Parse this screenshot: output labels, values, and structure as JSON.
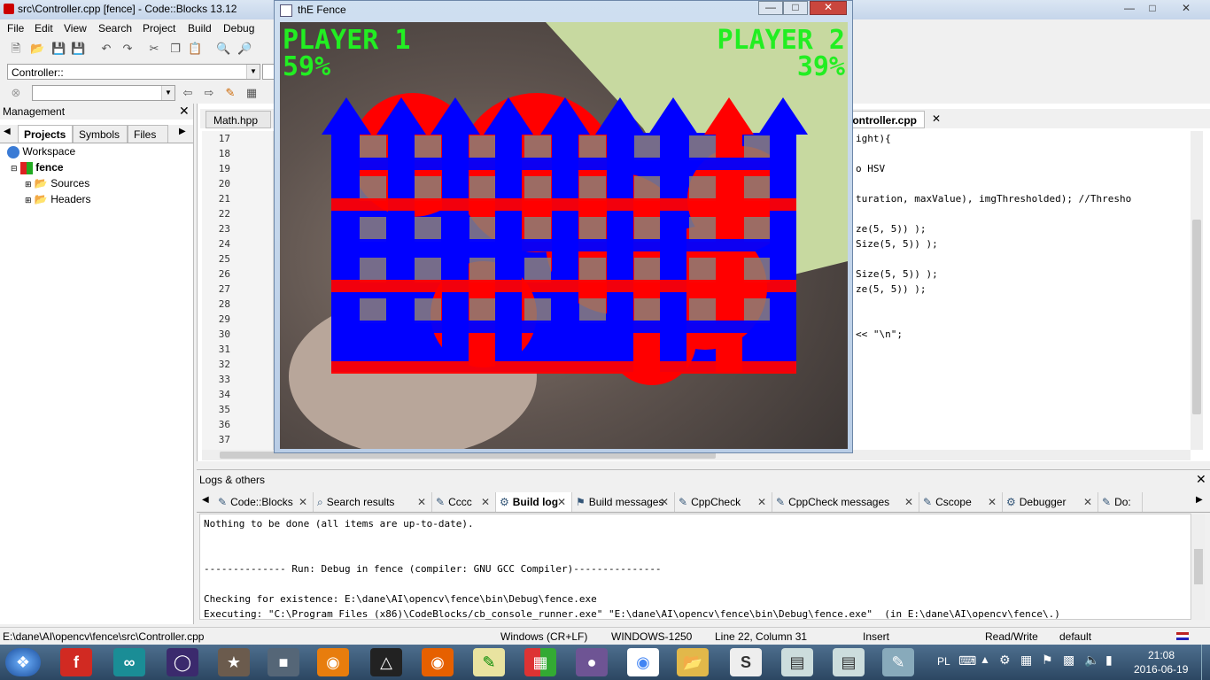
{
  "ide": {
    "title": "src\\Controller.cpp [fence] - Code::Blocks 13.12",
    "menu": [
      "File",
      "Edit",
      "Search",
      "View",
      "Project",
      "Build",
      "Debug",
      "Fortran"
    ],
    "scope_combo": "Controller::",
    "search_combo": ""
  },
  "management": {
    "title": "Management",
    "tabs": [
      "Projects",
      "Symbols",
      "Files"
    ],
    "tree": {
      "workspace": "Workspace",
      "project": "fence",
      "folders": [
        "Sources",
        "Headers"
      ]
    }
  },
  "editor": {
    "tabs": [
      "Math.hpp",
      "Controller.cpp"
    ],
    "line_numbers": [
      "17",
      "18",
      "19",
      "20",
      "21",
      "22",
      "23",
      "24",
      "25",
      "26",
      "27",
      "28",
      "29",
      "30",
      "31",
      "32",
      "33",
      "34",
      "35",
      "36",
      "37"
    ],
    "visible_code": [
      {
        "line": "17",
        "text": "ight){"
      },
      {
        "line": "19",
        "text": "o HSV"
      },
      {
        "line": "21",
        "text": "turation, maxValue), imgThresholded); //Thresho"
      },
      {
        "line": "23",
        "text": "ze(5, 5)) );"
      },
      {
        "line": "24",
        "text": "Size(5, 5)) );"
      },
      {
        "line": "26",
        "text": "Size(5, 5)) );"
      },
      {
        "line": "27",
        "text": "ze(5, 5)) );"
      },
      {
        "line": "30",
        "text": "<< \"\\n\";"
      }
    ]
  },
  "fence_window": {
    "title": "thE Fence",
    "player1_label": "PLAYER 1",
    "player1_score": "59%",
    "player2_label": "PLAYER 2",
    "player2_score": "39%",
    "player1_color": "#0000ff",
    "player2_color": "#ff0000",
    "score_color": "#22ee22"
  },
  "logs": {
    "title": "Logs & others",
    "tabs": [
      {
        "label": "Code::Blocks",
        "icon": "doc-icon"
      },
      {
        "label": "Search results",
        "icon": "search-icon"
      },
      {
        "label": "Cccc",
        "icon": "doc-icon"
      },
      {
        "label": "Build log",
        "icon": "gear-icon"
      },
      {
        "label": "Build messages",
        "icon": "pin-icon"
      },
      {
        "label": "CppCheck",
        "icon": "doc-icon"
      },
      {
        "label": "CppCheck messages",
        "icon": "doc-icon"
      },
      {
        "label": "Cscope",
        "icon": "doc-icon"
      },
      {
        "label": "Debugger",
        "icon": "gear-icon"
      },
      {
        "label": "Do:",
        "icon": "doc-icon"
      }
    ],
    "active_tab": "Build log",
    "lines": [
      "Nothing to be done (all items are up-to-date).",
      "",
      "",
      "-------------- Run: Debug in fence (compiler: GNU GCC Compiler)---------------",
      "",
      "Checking for existence: E:\\dane\\AI\\opencv\\fence\\bin\\Debug\\fence.exe",
      "Executing: \"C:\\Program Files (x86)\\CodeBlocks/cb_console_runner.exe\" \"E:\\dane\\AI\\opencv\\fence\\bin\\Debug\\fence.exe\"  (in E:\\dane\\AI\\opencv\\fence\\.)"
    ]
  },
  "status": {
    "path": "E:\\dane\\AI\\opencv\\fence\\src\\Controller.cpp",
    "eol": "Windows (CR+LF)",
    "encoding": "WINDOWS-1250",
    "position": "Line 22, Column 31",
    "mode": "Insert",
    "access": "Read/Write",
    "profile": "default"
  },
  "taskbar": {
    "language": "PL",
    "time": "21:08",
    "date": "2016-06-19"
  }
}
